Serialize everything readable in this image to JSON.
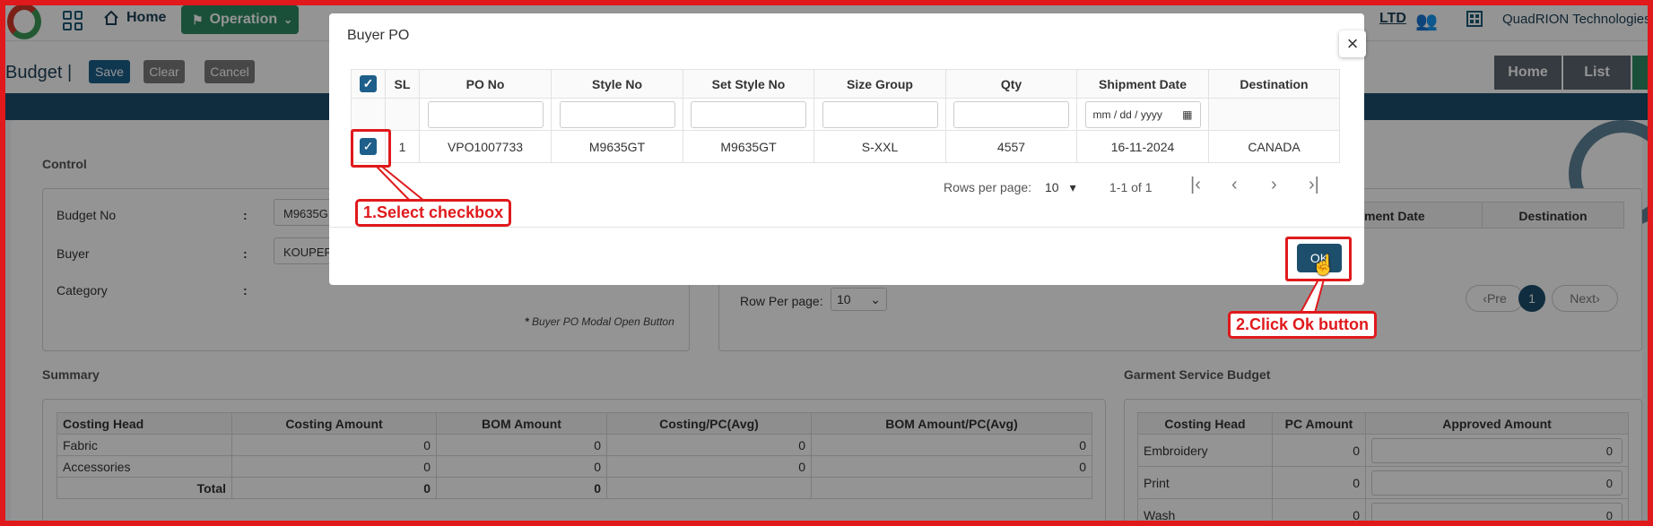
{
  "topbar": {
    "home_label": "Home",
    "operation_label": "Operation",
    "ltd_label": "LTD",
    "company_name": "QuadRION Technologies"
  },
  "toolbar": {
    "page_title": "Budget |",
    "save_label": "Save",
    "clear_label": "Clear",
    "cancel_label": "Cancel",
    "breadcrumb_home": "Home",
    "breadcrumb_list": "List"
  },
  "control": {
    "legend": "Control",
    "budget_no_label": "Budget No",
    "budget_no_value": "M9635G",
    "buyer_label": "Buyer",
    "buyer_value": "KOUPER",
    "category_label": "Category",
    "colon": ":",
    "modal_note": "Buyer PO Modal Open Button"
  },
  "po_panel": {
    "shipment_date_header": "ment Date",
    "destination_header": "Destination",
    "row_per_page_label": "Row Per page:",
    "row_per_page_value": "10",
    "prev_label": "Pre",
    "page_number": "1",
    "next_label": "Next"
  },
  "summary": {
    "legend": "Summary",
    "headers": [
      "Costing Head",
      "Costing Amount",
      "BOM Amount",
      "Costing/PC(Avg)",
      "BOM Amount/PC(Avg)"
    ],
    "rows": [
      [
        "Fabric",
        "0",
        "0",
        "0",
        "0"
      ],
      [
        "Accessories",
        "0",
        "0",
        "0",
        "0"
      ]
    ],
    "total_label": "Total",
    "total_costing": "0",
    "total_bom": "0"
  },
  "garment": {
    "legend": "Garment Service Budget",
    "headers": [
      "Costing Head",
      "PC Amount",
      "Approved Amount"
    ],
    "rows": [
      [
        "Embroidery",
        "0",
        "0"
      ],
      [
        "Print",
        "0",
        "0"
      ],
      [
        "Wash",
        "0",
        "0"
      ]
    ]
  },
  "modal": {
    "title": "Buyer PO",
    "close_symbol": "×",
    "headers": [
      "SL",
      "PO No",
      "Style No",
      "Set Style No",
      "Size Group",
      "Qty",
      "Shipment Date",
      "Destination"
    ],
    "date_placeholder": "mm / dd / yyyy",
    "row": {
      "sl": "1",
      "po_no": "VPO1007733",
      "style_no": "M9635GT",
      "set_style_no": "M9635GT",
      "size_group": "S-XXL",
      "qty": "4557",
      "shipment_date": "16-11-2024",
      "destination": "CANADA"
    },
    "rows_per_page_label": "Rows per page:",
    "rows_per_page_value": "10",
    "range_label": "1-1 of 1",
    "ok_label": "OK"
  },
  "annotations": {
    "step1": "1.Select checkbox",
    "step2": "2.Click Ok button"
  },
  "colors": {
    "accent": "#1d4f6d",
    "callout": "#e0191c",
    "operation": "#2d8a62"
  }
}
